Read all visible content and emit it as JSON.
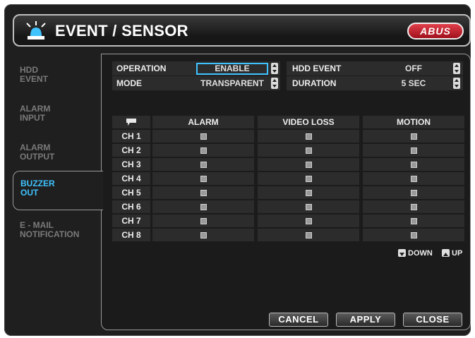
{
  "title": "EVENT / SENSOR",
  "logo": "ABUS",
  "icons": {
    "title": "siren-icon",
    "header_channel": "speech-bubble-icon",
    "down": "arrow-down-icon",
    "up": "arrow-up-icon"
  },
  "sidebar": {
    "items": [
      {
        "line1": "HDD",
        "line2": "EVENT"
      },
      {
        "line1": "ALARM",
        "line2": "INPUT"
      },
      {
        "line1": "ALARM",
        "line2": "OUTPUT"
      },
      {
        "line1": "BUZZER",
        "line2": "OUT"
      },
      {
        "line1": "E - MAIL",
        "line2": "NOTIFICATION"
      }
    ],
    "active_index": 3
  },
  "settings": {
    "operation_label": "OPERATION",
    "operation_value": "ENABLE",
    "mode_label": "MODE",
    "mode_value": "TRANSPARENT",
    "hdd_event_label": "HDD EVENT",
    "hdd_event_value": "OFF",
    "duration_label": "DURATION",
    "duration_value": "5 SEC"
  },
  "table": {
    "columns": [
      "ALARM",
      "VIDEO LOSS",
      "MOTION"
    ],
    "rows": [
      "CH 1",
      "CH 2",
      "CH 3",
      "CH 4",
      "CH 5",
      "CH 6",
      "CH 7",
      "CH 8"
    ]
  },
  "paging": {
    "down_label": "DOWN",
    "up_label": "UP"
  },
  "buttons": {
    "cancel": "CANCEL",
    "apply": "APPLY",
    "close": "CLOSE"
  },
  "colors": {
    "accent": "#3ec3ff",
    "logo_red": "#c01c28",
    "background": "#1f1f1f"
  }
}
